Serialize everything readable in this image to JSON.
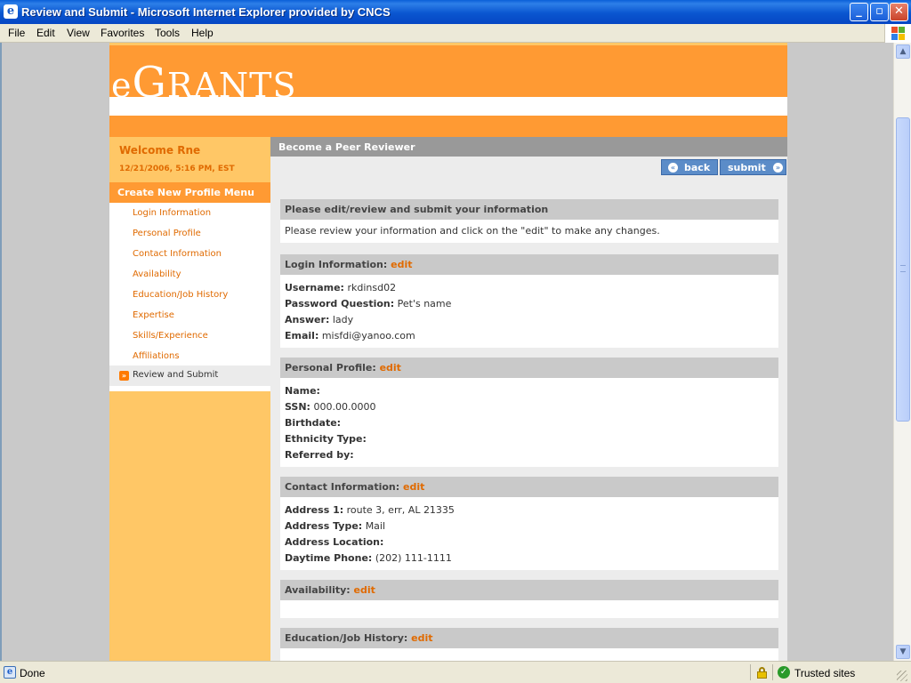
{
  "window": {
    "title": "Review and Submit - Microsoft Internet Explorer provided by CNCS"
  },
  "menubar": [
    "File",
    "Edit",
    "View",
    "Favorites",
    "Tools",
    "Help"
  ],
  "site": {
    "logo": "eGRANTS",
    "logo_first": "e",
    "logo_big": "G",
    "logo_rest": "RANTS"
  },
  "sidebar": {
    "welcome": "Welcome Rne",
    "datetime": "12/21/2006, 5:16 PM, EST",
    "menu_title": "Create New Profile Menu",
    "items": [
      "Login Information",
      "Personal Profile",
      "Contact Information",
      "Availability",
      "Education/Job History",
      "Expertise",
      "Skills/Experience",
      "Affiliations"
    ],
    "active_item": "Review and Submit"
  },
  "main": {
    "page_title": "Become a Peer Reviewer",
    "back_label": "back",
    "submit_label": "submit",
    "edit_label": "edit",
    "intro": {
      "heading": "Please edit/review and submit your information",
      "text": "Please review your information and click on the \"edit\" to make any changes."
    },
    "login": {
      "heading": "Login Information:",
      "username_label": "Username:",
      "username": "rkdinsd02",
      "question_label": "Password Question:",
      "question": "Pet's name",
      "answer_label": "Answer:",
      "answer": "lady",
      "email_label": "Email:",
      "email": "misfdi@yanoo.com"
    },
    "personal": {
      "heading": "Personal Profile:",
      "name_label": "Name:",
      "ssn_label": "SSN:",
      "ssn": "000.00.0000",
      "birthdate_label": "Birthdate:",
      "ethnicity_label": "Ethnicity Type:",
      "referred_label": "Referred by:"
    },
    "contact": {
      "heading": "Contact Information:",
      "address1_label": "Address 1:",
      "address1": "route 3, err, AL 21335",
      "address_type_label": "Address Type:",
      "address_type": "Mail",
      "address_location_label": "Address Location:",
      "phone_label": "Daytime Phone:",
      "phone": "(202) 111-1111"
    },
    "availability": {
      "heading": "Availability:"
    },
    "education": {
      "heading": "Education/Job History:"
    }
  },
  "statusbar": {
    "status": "Done",
    "zone": "Trusted sites"
  }
}
